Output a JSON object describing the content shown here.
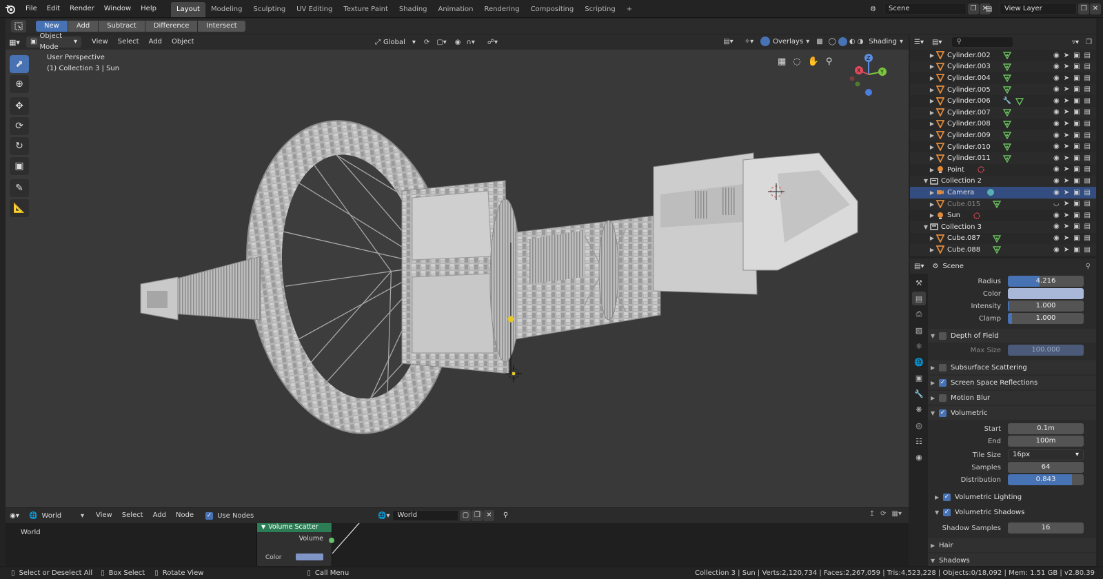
{
  "topbar": {
    "menus": [
      "File",
      "Edit",
      "Render",
      "Window",
      "Help"
    ],
    "workspaces": [
      "Layout",
      "Modeling",
      "Sculpting",
      "UV Editing",
      "Texture Paint",
      "Shading",
      "Animation",
      "Rendering",
      "Compositing",
      "Scripting"
    ],
    "active_workspace": "Layout",
    "add_workspace": "+",
    "scene_name": "Scene",
    "view_layer_name": "View Layer"
  },
  "tool_header": {
    "buttons": [
      "New",
      "Add",
      "Subtract",
      "Difference",
      "Intersect"
    ]
  },
  "viewport_header": {
    "mode": "Object Mode",
    "menus": [
      "View",
      "Select",
      "Add",
      "Object"
    ],
    "transform_orientation": "Global",
    "overlays_label": "Overlays",
    "shading_label": "Shading"
  },
  "viewport": {
    "view_name": "User Perspective",
    "context_info": "(1) Collection 3 | Sun",
    "gizmo_axes": [
      "Z",
      "Y",
      "X"
    ]
  },
  "outliner": {
    "search_placeholder": "",
    "rows": [
      {
        "name": "Cylinder.002",
        "type": "mesh",
        "indent": 3,
        "extra": "mesh-data"
      },
      {
        "name": "Cylinder.003",
        "type": "mesh",
        "indent": 3,
        "extra": "mesh-data"
      },
      {
        "name": "Cylinder.004",
        "type": "mesh",
        "indent": 3,
        "extra": "mesh-data"
      },
      {
        "name": "Cylinder.005",
        "type": "mesh",
        "indent": 3,
        "extra": "mesh-data"
      },
      {
        "name": "Cylinder.006",
        "type": "mesh",
        "indent": 3,
        "extra": "modifier-mesh"
      },
      {
        "name": "Cylinder.007",
        "type": "mesh",
        "indent": 3,
        "extra": "mesh-data"
      },
      {
        "name": "Cylinder.008",
        "type": "mesh",
        "indent": 3,
        "extra": "mesh-data"
      },
      {
        "name": "Cylinder.009",
        "type": "mesh",
        "indent": 3,
        "extra": "mesh-data"
      },
      {
        "name": "Cylinder.010",
        "type": "mesh",
        "indent": 3,
        "extra": "mesh-data"
      },
      {
        "name": "Cylinder.011",
        "type": "mesh",
        "indent": 3,
        "extra": "mesh-data"
      },
      {
        "name": "Point",
        "type": "light",
        "indent": 3,
        "extra": "light-data"
      },
      {
        "name": "Collection 2",
        "type": "collection",
        "indent": 2,
        "extra": ""
      },
      {
        "name": "Camera",
        "type": "camera",
        "indent": 3,
        "extra": "camera-data",
        "selected": true
      },
      {
        "name": "Cube.015",
        "type": "mesh",
        "indent": 3,
        "extra": "mesh-data",
        "dim": true
      },
      {
        "name": "Sun",
        "type": "light",
        "indent": 3,
        "extra": "light-data"
      },
      {
        "name": "Collection 3",
        "type": "collection",
        "indent": 2,
        "extra": ""
      },
      {
        "name": "Cube.087",
        "type": "mesh",
        "indent": 3,
        "extra": "mesh-data"
      },
      {
        "name": "Cube.088",
        "type": "mesh",
        "indent": 3,
        "extra": "mesh-data"
      }
    ]
  },
  "properties": {
    "context": "Scene",
    "fields_top": [
      {
        "label": "Radius",
        "value": "4.216",
        "fill": 0.42
      },
      {
        "label": "Color",
        "value": "",
        "fill": 1,
        "swatch": "#a9b8d8"
      },
      {
        "label": "Intensity",
        "value": "1.000",
        "fill": 0.02
      },
      {
        "label": "Clamp",
        "value": "1.000",
        "fill": 0.05
      }
    ],
    "dof": {
      "label": "Depth of Field",
      "checked": false,
      "open": true,
      "field_label": "Max Size",
      "field_value": "100.000"
    },
    "panels_mid": [
      {
        "label": "Subsurface Scattering",
        "checked": false
      },
      {
        "label": "Screen Space Reflections",
        "checked": true
      },
      {
        "label": "Motion Blur",
        "checked": false
      }
    ],
    "volumetric": {
      "label": "Volumetric",
      "checked": true,
      "fields": [
        {
          "label": "Start",
          "value": "0.1m",
          "fill": 0
        },
        {
          "label": "End",
          "value": "100m",
          "fill": 0
        }
      ],
      "tile_size_label": "Tile Size",
      "tile_size_value": "16px",
      "fields2": [
        {
          "label": "Samples",
          "value": "64",
          "fill": 0
        },
        {
          "label": "Distribution",
          "value": "0.843",
          "fill": 0.843
        }
      ],
      "sub_panels": [
        {
          "label": "Volumetric Lighting",
          "checked": true,
          "open": false
        },
        {
          "label": "Volumetric Shadows",
          "checked": true,
          "open": true
        }
      ],
      "shadow_samples_label": "Shadow Samples",
      "shadow_samples_value": "16"
    },
    "panels_bottom": [
      {
        "label": "Hair",
        "open": false
      },
      {
        "label": "Shadows",
        "open": true
      }
    ]
  },
  "node_editor": {
    "type_label": "World",
    "menus": [
      "View",
      "Select",
      "Add",
      "Node"
    ],
    "use_nodes_label": "Use Nodes",
    "use_nodes_checked": true,
    "world_name": "World",
    "canvas_label": "World",
    "node_title": "Volume Scatter",
    "node_output": "Volume",
    "node_input": "Color"
  },
  "statusbar": {
    "hints": [
      "Select or Deselect All",
      "Box Select",
      "Rotate View",
      "Call Menu"
    ],
    "stats": "Collection 3 | Sun | Verts:2,120,734 | Faces:2,267,059 | Tris:4,523,228 | Objects:0/18,092 | Mem: 1.51 GB | v2.80.39"
  },
  "colors": {
    "accent": "#4772b3",
    "mesh_icon": "#e08a3c",
    "mesh_data_icon": "#68c05c",
    "selected_row": "#334d80",
    "node_header": "#2c7d55"
  }
}
